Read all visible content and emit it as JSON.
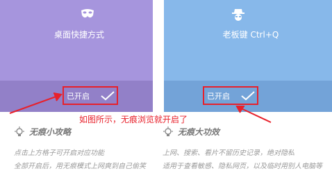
{
  "cards": [
    {
      "icon": "mask-icon",
      "title": "桌面快捷方式",
      "status": "已开启"
    },
    {
      "icon": "boss-key-icon",
      "title": "老板键 Ctrl+Q",
      "status": "已开启"
    }
  ],
  "annotation": "如图所示，无痕浏览就开启了",
  "tips": [
    {
      "title": "无痕小攻略",
      "lines": [
        "点击上方格子可开启对应功能",
        "全部开启后，用无痕模式上网爽到自己偷笑"
      ]
    },
    {
      "title": "无痕大功效",
      "lines": [
        "上网、搜索、看片不留历史记录，绝对隐私",
        "适用于查看敏感、隐私网页，以及临时用别人电脑等"
      ]
    }
  ],
  "colors": {
    "left_card": "#a695dd",
    "right_card": "#87b8ea",
    "highlight": "#e8202a"
  }
}
